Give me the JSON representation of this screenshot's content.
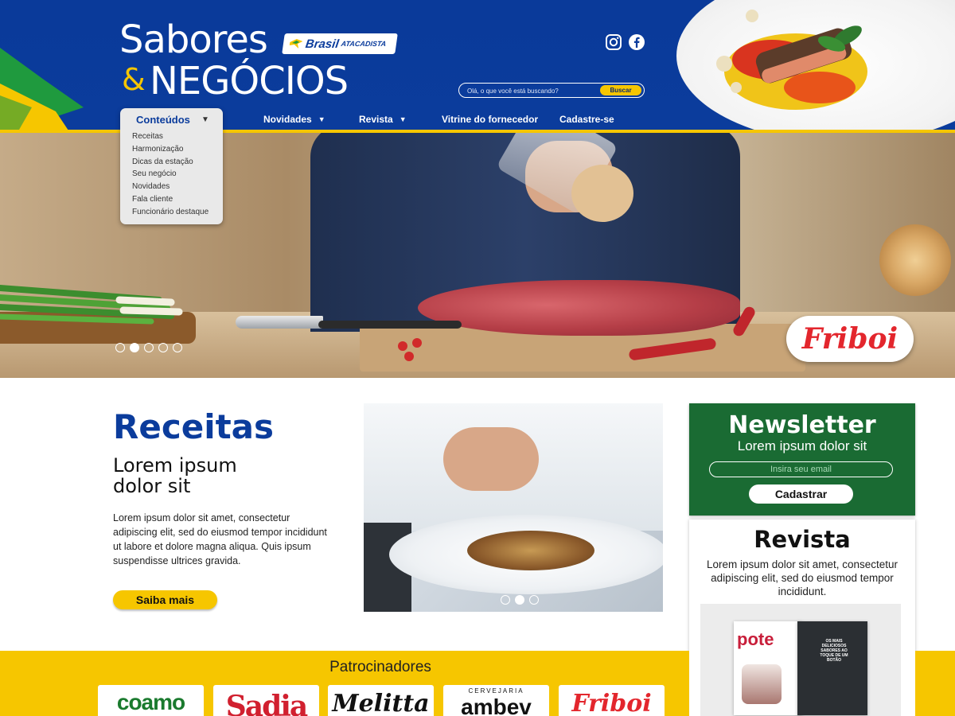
{
  "header": {
    "logo_line1": "Sabores",
    "logo_amp": "&",
    "logo_line2": "NEGÓCIOS",
    "badge_brand": "Brasil",
    "badge_sub": "ATACADISTA",
    "search": {
      "placeholder": "Olá, o que você está buscando?",
      "button": "Buscar"
    },
    "social": [
      "instagram-icon",
      "facebook-icon"
    ]
  },
  "nav": {
    "dropdown": {
      "title": "Conteúdos",
      "items": [
        "Receitas",
        "Harmonização",
        "Dicas da estação",
        "Seu negócio",
        "Novidades",
        "Fala cliente",
        "Funcionário destaque"
      ]
    },
    "items": [
      {
        "label": "Novidades",
        "has_caret": true
      },
      {
        "label": "Revista",
        "has_caret": true
      },
      {
        "label": "Vitrine do fornecedor",
        "has_caret": false
      },
      {
        "label": "Cadastre-se",
        "has_caret": false
      }
    ]
  },
  "hero": {
    "sponsor_badge": "Friboi",
    "slides": 5,
    "active_slide": 2
  },
  "receitas": {
    "title": "Receitas",
    "subtitle_line1": "Lorem ipsum",
    "subtitle_line2": "dolor sit",
    "body": "Lorem ipsum dolor sit amet, consectetur adipiscing elit, sed do eiusmod tempor incididunt ut labore et dolore magna aliqua. Quis ipsum suspendisse ultrices gravida.",
    "button": "Saiba mais",
    "carousel_slides": 3,
    "carousel_active": 2
  },
  "newsletter": {
    "title": "Newsletter",
    "subtitle": "Lorem ipsum dolor sit",
    "input_placeholder": "Insira seu email",
    "button": "Cadastrar"
  },
  "revista": {
    "title": "Revista",
    "body": "Lorem ipsum dolor sit amet, consectetur adipiscing elit, sed do eiusmod tempor incididunt.",
    "cover_title": "pote",
    "cover_text": "OS MAIS DELICIOSOS SABORES AO TOQUE DE UM BOTÃO"
  },
  "sponsors": {
    "title": "Patrocinadores",
    "logos": [
      "coamo",
      "Sadia",
      "Melitta",
      "ambev",
      "Friboi"
    ],
    "ambev_top": "CERVEJARIA"
  },
  "colors": {
    "brand_blue": "#0b3c9c",
    "brand_yellow": "#f6c600",
    "newsletter_green": "#1a6b33",
    "friboi_red": "#e3262d"
  }
}
